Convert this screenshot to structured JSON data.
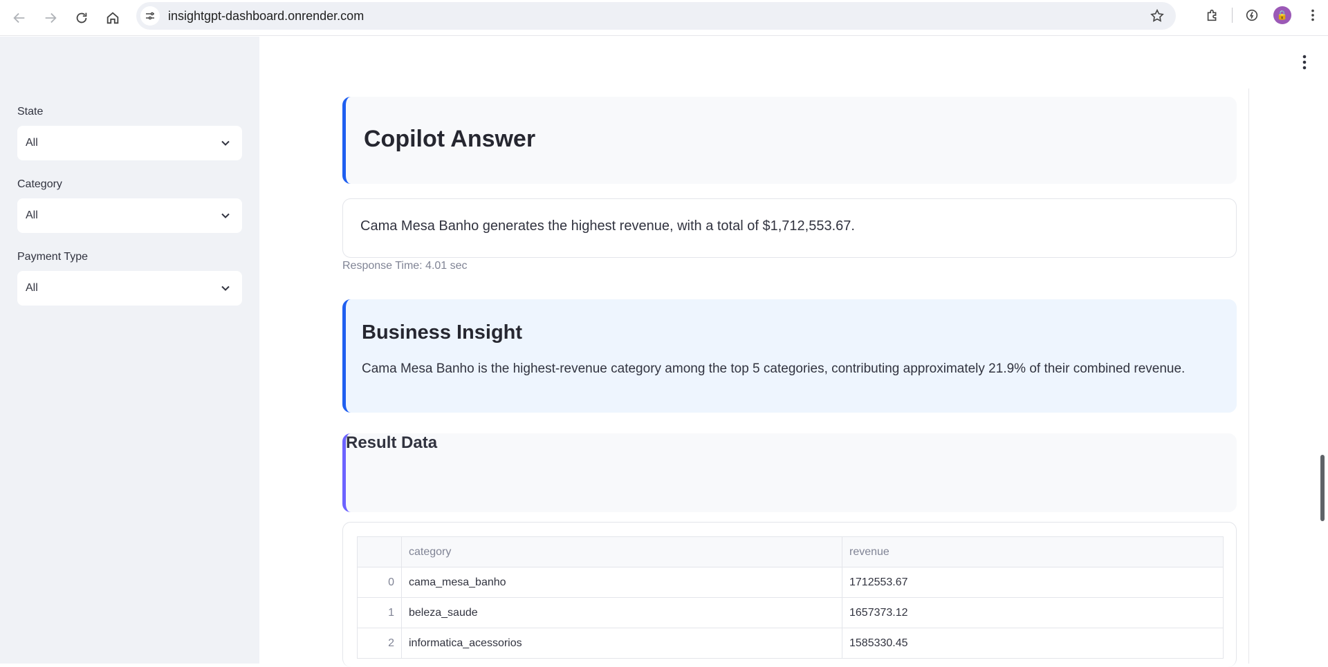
{
  "browser": {
    "url": "insightgpt-dashboard.onrender.com",
    "avatar_glyph": "🔒"
  },
  "sidebar": {
    "filters": [
      {
        "label": "State",
        "value": "All"
      },
      {
        "label": "Category",
        "value": "All"
      },
      {
        "label": "Payment Type",
        "value": "All"
      }
    ]
  },
  "main": {
    "copilot_heading": "Copilot Answer",
    "answer_text": "Cama Mesa Banho generates the highest revenue, with a total of $1,712,553.67.",
    "response_time": "Response Time: 4.01 sec",
    "insight_heading": "Business Insight",
    "insight_text": "Cama Mesa Banho is the highest-revenue category among the top 5 categories, contributing approximately 21.9% of their combined revenue.",
    "result_heading": "Result Data",
    "table": {
      "columns": [
        "",
        "category",
        "revenue"
      ],
      "rows": [
        {
          "index": "0",
          "category": "cama_mesa_banho",
          "revenue": "1712553.67"
        },
        {
          "index": "1",
          "category": "beleza_saude",
          "revenue": "1657373.12"
        },
        {
          "index": "2",
          "category": "informatica_acessorios",
          "revenue": "1585330.45"
        }
      ]
    }
  },
  "colors": {
    "accent_blue": "#1f5ff0",
    "accent_purple": "#6c63ff",
    "sidebar_bg": "#f0f2f6",
    "insight_bg": "#eef5fe"
  }
}
